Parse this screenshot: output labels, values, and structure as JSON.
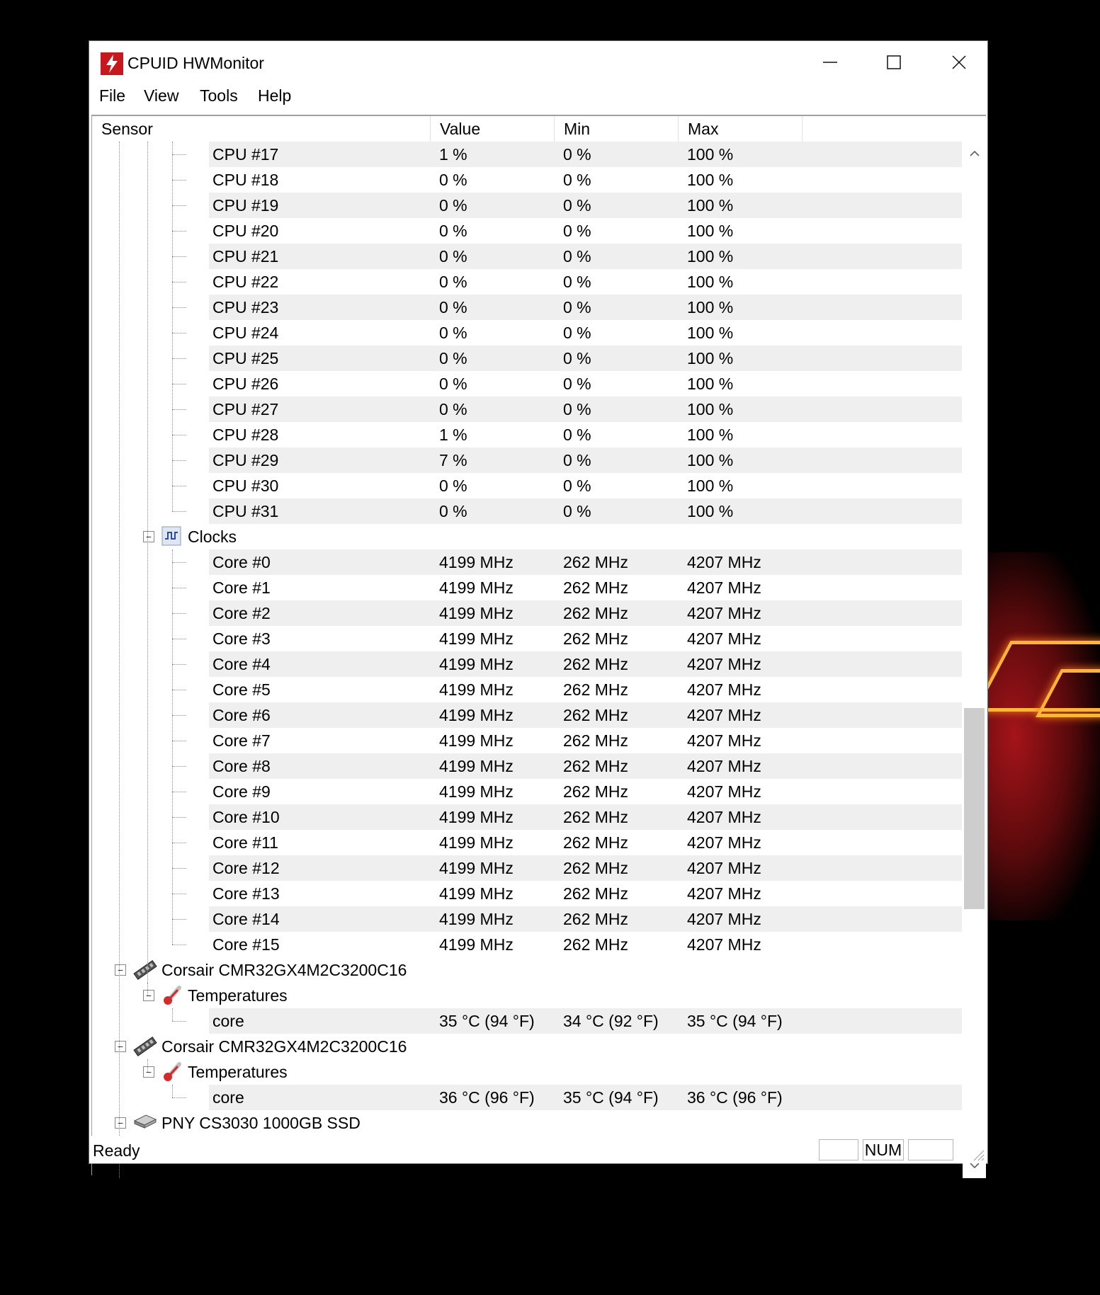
{
  "window": {
    "title": "CPUID HWMonitor"
  },
  "menu": [
    "File",
    "View",
    "Tools",
    "Help"
  ],
  "columns": [
    "Sensor",
    "Value",
    "Min",
    "Max"
  ],
  "rows": [
    {
      "level": 3,
      "label": "CPU #17",
      "value": "1 %",
      "min": "0 %",
      "max": "100 %"
    },
    {
      "level": 3,
      "label": "CPU #18",
      "value": "0 %",
      "min": "0 %",
      "max": "100 %"
    },
    {
      "level": 3,
      "label": "CPU #19",
      "value": "0 %",
      "min": "0 %",
      "max": "100 %"
    },
    {
      "level": 3,
      "label": "CPU #20",
      "value": "0 %",
      "min": "0 %",
      "max": "100 %"
    },
    {
      "level": 3,
      "label": "CPU #21",
      "value": "0 %",
      "min": "0 %",
      "max": "100 %"
    },
    {
      "level": 3,
      "label": "CPU #22",
      "value": "0 %",
      "min": "0 %",
      "max": "100 %"
    },
    {
      "level": 3,
      "label": "CPU #23",
      "value": "0 %",
      "min": "0 %",
      "max": "100 %"
    },
    {
      "level": 3,
      "label": "CPU #24",
      "value": "0 %",
      "min": "0 %",
      "max": "100 %"
    },
    {
      "level": 3,
      "label": "CPU #25",
      "value": "0 %",
      "min": "0 %",
      "max": "100 %"
    },
    {
      "level": 3,
      "label": "CPU #26",
      "value": "0 %",
      "min": "0 %",
      "max": "100 %"
    },
    {
      "level": 3,
      "label": "CPU #27",
      "value": "0 %",
      "min": "0 %",
      "max": "100 %"
    },
    {
      "level": 3,
      "label": "CPU #28",
      "value": "1 %",
      "min": "0 %",
      "max": "100 %"
    },
    {
      "level": 3,
      "label": "CPU #29",
      "value": "7 %",
      "min": "0 %",
      "max": "100 %"
    },
    {
      "level": 3,
      "label": "CPU #30",
      "value": "0 %",
      "min": "0 %",
      "max": "100 %"
    },
    {
      "level": 3,
      "label": "CPU #31",
      "value": "0 %",
      "min": "0 %",
      "max": "100 %"
    },
    {
      "level": 2,
      "label": "Clocks",
      "icon": "clock-wave-icon"
    },
    {
      "level": 3,
      "label": "Core #0",
      "value": "4199 MHz",
      "min": "262 MHz",
      "max": "4207 MHz"
    },
    {
      "level": 3,
      "label": "Core #1",
      "value": "4199 MHz",
      "min": "262 MHz",
      "max": "4207 MHz"
    },
    {
      "level": 3,
      "label": "Core #2",
      "value": "4199 MHz",
      "min": "262 MHz",
      "max": "4207 MHz"
    },
    {
      "level": 3,
      "label": "Core #3",
      "value": "4199 MHz",
      "min": "262 MHz",
      "max": "4207 MHz"
    },
    {
      "level": 3,
      "label": "Core #4",
      "value": "4199 MHz",
      "min": "262 MHz",
      "max": "4207 MHz"
    },
    {
      "level": 3,
      "label": "Core #5",
      "value": "4199 MHz",
      "min": "262 MHz",
      "max": "4207 MHz"
    },
    {
      "level": 3,
      "label": "Core #6",
      "value": "4199 MHz",
      "min": "262 MHz",
      "max": "4207 MHz"
    },
    {
      "level": 3,
      "label": "Core #7",
      "value": "4199 MHz",
      "min": "262 MHz",
      "max": "4207 MHz"
    },
    {
      "level": 3,
      "label": "Core #8",
      "value": "4199 MHz",
      "min": "262 MHz",
      "max": "4207 MHz"
    },
    {
      "level": 3,
      "label": "Core #9",
      "value": "4199 MHz",
      "min": "262 MHz",
      "max": "4207 MHz"
    },
    {
      "level": 3,
      "label": "Core #10",
      "value": "4199 MHz",
      "min": "262 MHz",
      "max": "4207 MHz"
    },
    {
      "level": 3,
      "label": "Core #11",
      "value": "4199 MHz",
      "min": "262 MHz",
      "max": "4207 MHz"
    },
    {
      "level": 3,
      "label": "Core #12",
      "value": "4199 MHz",
      "min": "262 MHz",
      "max": "4207 MHz"
    },
    {
      "level": 3,
      "label": "Core #13",
      "value": "4199 MHz",
      "min": "262 MHz",
      "max": "4207 MHz"
    },
    {
      "level": 3,
      "label": "Core #14",
      "value": "4199 MHz",
      "min": "262 MHz",
      "max": "4207 MHz"
    },
    {
      "level": 3,
      "label": "Core #15",
      "value": "4199 MHz",
      "min": "262 MHz",
      "max": "4207 MHz"
    },
    {
      "level": 1,
      "label": "Corsair CMR32GX4M2C3200C16",
      "icon": "memory-module-icon"
    },
    {
      "level": 2,
      "label": "Temperatures",
      "icon": "thermometer-icon"
    },
    {
      "level": 3,
      "label": "core",
      "value": "35 °C  (94 °F)",
      "min": "34 °C  (92 °F)",
      "max": "35 °C  (94 °F)"
    },
    {
      "level": 1,
      "label": "Corsair CMR32GX4M2C3200C16",
      "icon": "memory-module-icon"
    },
    {
      "level": 2,
      "label": "Temperatures",
      "icon": "thermometer-icon"
    },
    {
      "level": 3,
      "label": "core",
      "value": "36 °C  (96 °F)",
      "min": "35 °C  (94 °F)",
      "max": "36 °C  (96 °F)"
    },
    {
      "level": 1,
      "label": "PNY CS3030 1000GB SSD",
      "icon": "drive-icon"
    }
  ],
  "status": {
    "text": "Ready",
    "num": "NUM"
  },
  "colors": {
    "row_band": "#efefef",
    "app_icon": "#c8171e",
    "thermometer": "#d42a2a"
  }
}
